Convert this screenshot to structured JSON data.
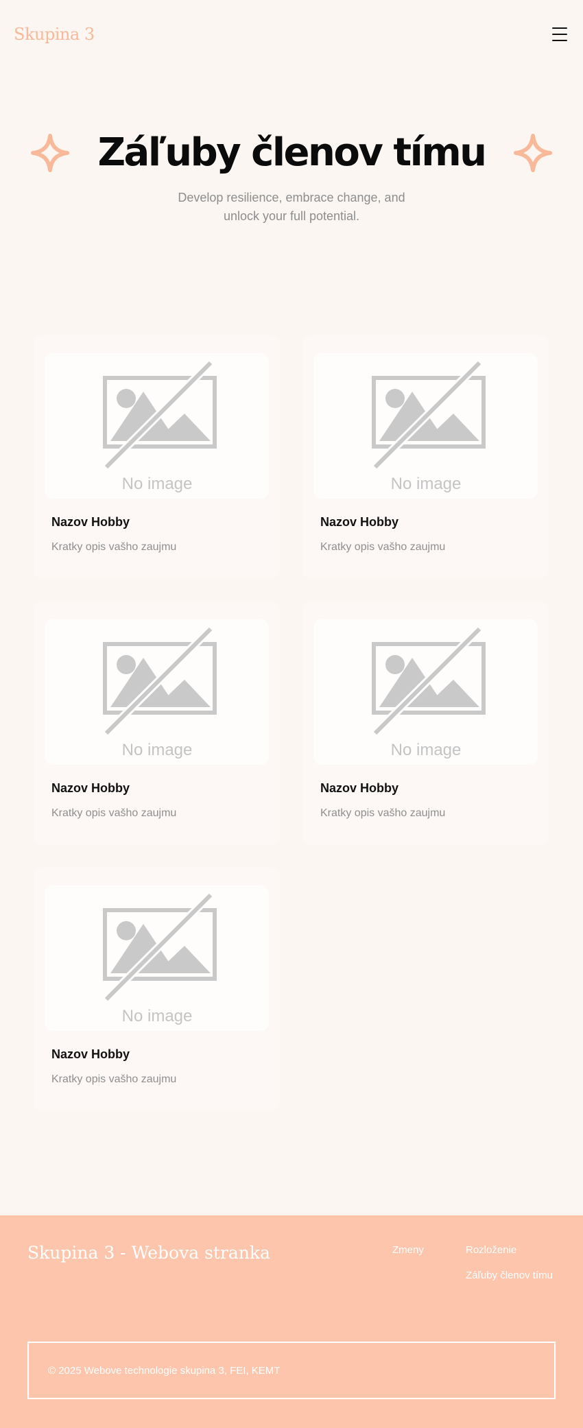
{
  "header": {
    "logo": "Skupina 3"
  },
  "hero": {
    "title": "Záľuby členov tímu",
    "subtitle": "Develop resilience, embrace change, and unlock your full potential."
  },
  "cards": [
    {
      "image_text": "No image",
      "title": "Nazov Hobby",
      "description": "Kratky opis vašho zaujmu"
    },
    {
      "image_text": "No image",
      "title": "Nazov Hobby",
      "description": "Kratky opis vašho zaujmu"
    },
    {
      "image_text": "No image",
      "title": "Nazov Hobby",
      "description": "Kratky opis vašho zaujmu"
    },
    {
      "image_text": "No image",
      "title": "Nazov Hobby",
      "description": "Kratky opis vašho zaujmu"
    },
    {
      "image_text": "No image",
      "title": "Nazov Hobby",
      "description": "Kratky opis vašho zaujmu"
    }
  ],
  "footer": {
    "brand": "Skupina 3 - Webova stranka",
    "links": [
      "Zmeny",
      "Rozloženie",
      "Záľuby členov tímu"
    ],
    "copyright": "© 2025 Webove technologie skupina 3, FEI, KEMT"
  },
  "colors": {
    "accent": "#f7b99a",
    "footer_bg": "#fdc5ab",
    "page_bg": "#fbf6f2"
  }
}
